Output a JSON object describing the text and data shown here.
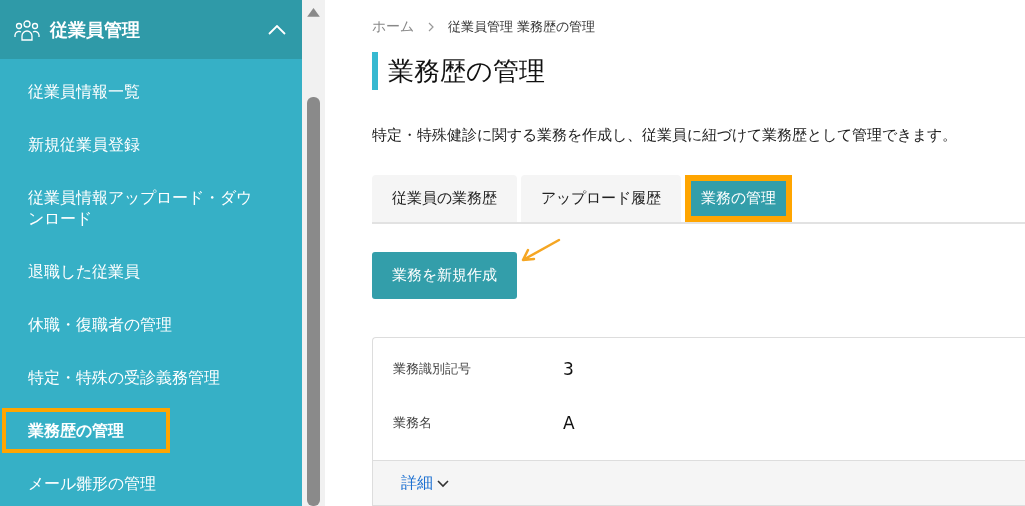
{
  "sidebar": {
    "section": {
      "title": "従業員管理",
      "expanded": true
    },
    "items": [
      {
        "label": "従業員情報一覧",
        "selected": false,
        "highlighted": false
      },
      {
        "label": "新規従業員登録",
        "selected": false,
        "highlighted": false
      },
      {
        "label": "従業員情報アップロード・ダウンロード",
        "selected": false,
        "highlighted": false
      },
      {
        "label": "退職した従業員",
        "selected": false,
        "highlighted": false
      },
      {
        "label": "休職・復職者の管理",
        "selected": false,
        "highlighted": false
      },
      {
        "label": "特定・特殊の受診義務管理",
        "selected": false,
        "highlighted": false
      },
      {
        "label": "業務歴の管理",
        "selected": true,
        "highlighted": true
      },
      {
        "label": "メール雛形の管理",
        "selected": false,
        "highlighted": false
      }
    ]
  },
  "breadcrumb": [
    "ホーム",
    "従業員管理 業務歴の管理"
  ],
  "page_title": "業務歴の管理",
  "description": "特定・特殊健診に関する業務を作成し、従業員に紐づけて業務歴として管理できます。",
  "tabs": [
    {
      "label": "従業員の業務歴",
      "selected": false,
      "highlighted": false
    },
    {
      "label": "アップロード履歴",
      "selected": false,
      "highlighted": false
    },
    {
      "label": "業務の管理",
      "selected": true,
      "highlighted": true
    }
  ],
  "create_button": {
    "label": "業務を新規作成",
    "highlighted": true
  },
  "card": {
    "fields": [
      {
        "label": "業務識別記号",
        "value": "3"
      },
      {
        "label": "業務名",
        "value": "A"
      }
    ],
    "details_link": "詳細"
  }
}
